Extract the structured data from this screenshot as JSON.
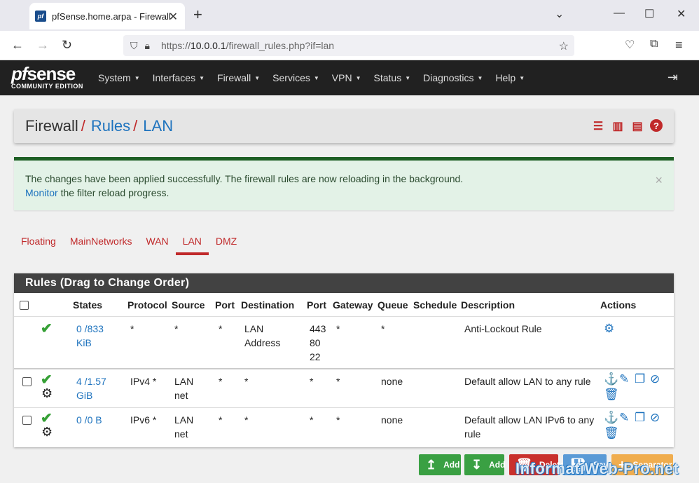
{
  "browser": {
    "tab_title": "pfSense.home.arpa - Firewall: R",
    "tab_favicon": "pf",
    "url_prefix": "https://",
    "url_host": "10.0.0.1",
    "url_path": "/firewall_rules.php?if=lan"
  },
  "pfsense": {
    "logo_pf": "pf",
    "logo_sense": "sense",
    "logo_sub": "COMMUNITY EDITION",
    "menu": [
      "System",
      "Interfaces",
      "Firewall",
      "Services",
      "VPN",
      "Status",
      "Diagnostics",
      "Help"
    ]
  },
  "breadcrumb": {
    "part1": "Firewall",
    "sep": "/",
    "part2": "Rules",
    "part3": "LAN"
  },
  "alert": {
    "line1": "The changes have been applied successfully. The firewall rules are now reloading in the background.",
    "link": "Monitor",
    "line2_rest": " the filter reload progress.",
    "close": "×"
  },
  "iftabs": [
    "Floating",
    "MainNetworks",
    "WAN",
    "LAN",
    "DMZ"
  ],
  "rules": {
    "heading": "Rules (Drag to Change Order)",
    "columns": [
      "States",
      "Protocol",
      "Source",
      "Port",
      "Destination",
      "Port",
      "Gateway",
      "Queue",
      "Schedule",
      "Description",
      "Actions"
    ],
    "rows": [
      {
        "states1": "0 /833",
        "states2": "KiB",
        "protocol": "*",
        "source1": "*",
        "source2": "",
        "sport": "*",
        "dest1": "LAN",
        "dest2": "Address",
        "dport1": "443",
        "dport2": "80",
        "dport3": "22",
        "gateway": "*",
        "queue": "*",
        "schedule": "",
        "desc1": "Anti-Lockout Rule",
        "desc2": ""
      },
      {
        "states1": "4 /1.57",
        "states2": "GiB",
        "protocol": "IPv4 *",
        "source1": "LAN",
        "source2": "net",
        "sport": "*",
        "dest1": "*",
        "dest2": "",
        "dport1": "*",
        "dport2": "",
        "dport3": "",
        "gateway": "*",
        "queue": "none",
        "schedule": "",
        "desc1": "Default allow LAN to any rule",
        "desc2": ""
      },
      {
        "states1": "0 /0 B",
        "states2": "",
        "protocol": "IPv6 *",
        "source1": "LAN",
        "source2": "net",
        "sport": "*",
        "dest1": "*",
        "dest2": "",
        "dport1": "*",
        "dport2": "",
        "dport3": "",
        "gateway": "*",
        "queue": "none",
        "schedule": "",
        "desc1": "Default allow LAN IPv6 to any",
        "desc2": "rule"
      }
    ]
  },
  "buttons": {
    "add_top": "Add",
    "add_bottom": "Add",
    "delete": "Delete",
    "save": "Save",
    "separator": "Separator"
  },
  "watermark": "InformatiWeb-Pro.net",
  "colors": {
    "accent_red": "#c0292a",
    "link_blue": "#1e73be",
    "nav_dark": "#212121",
    "success_green": "#35a035"
  }
}
